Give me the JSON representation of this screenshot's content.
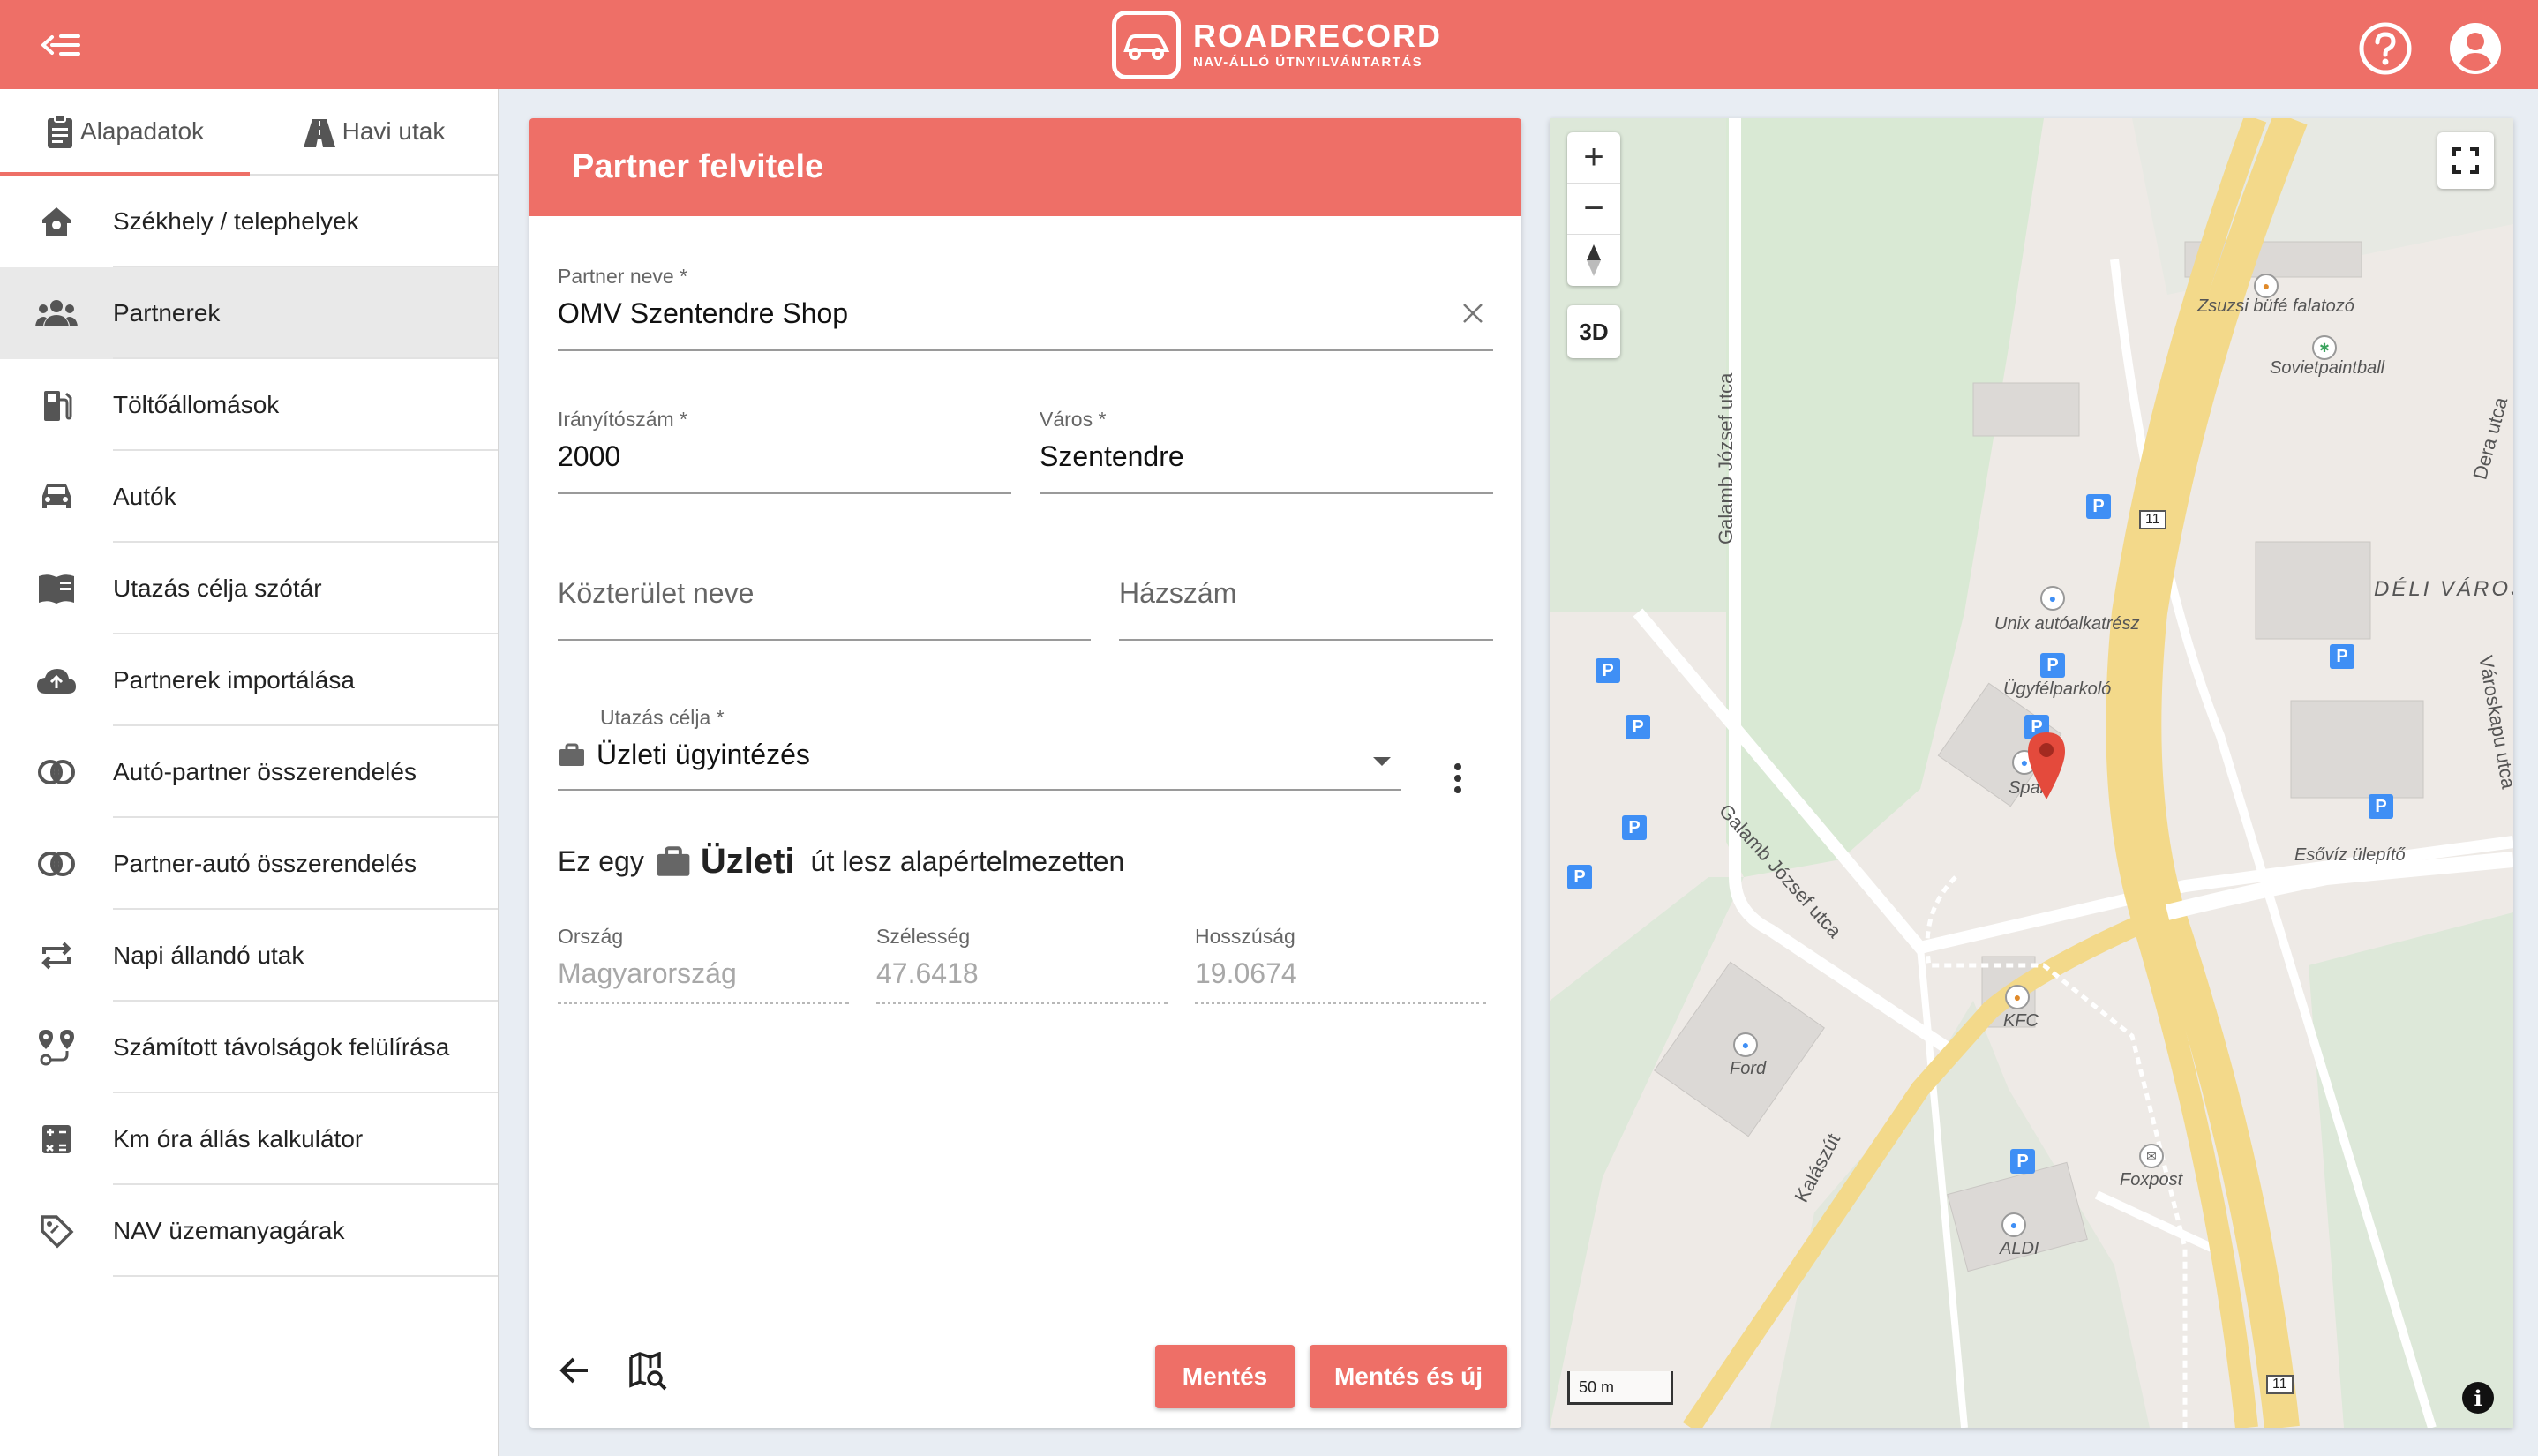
{
  "app": {
    "brand_title": "ROADRECORD",
    "brand_subtitle": "NAV-ÁLLÓ ÚTNYILVÁNTARTÁS",
    "accent_color": "#ee6f67"
  },
  "sidebar": {
    "tabs": [
      {
        "label": "Alapadatok",
        "icon": "clipboard-icon",
        "active": true
      },
      {
        "label": "Havi utak",
        "icon": "road-icon",
        "active": false
      }
    ],
    "items": [
      {
        "label": "Székhely / telephelyek",
        "icon": "home-pin-icon",
        "active": false
      },
      {
        "label": "Partnerek",
        "icon": "people-icon",
        "active": true
      },
      {
        "label": "Töltőállomások",
        "icon": "fuel-icon",
        "active": false
      },
      {
        "label": "Autók",
        "icon": "car-icon",
        "active": false
      },
      {
        "label": "Utazás célja szótár",
        "icon": "book-icon",
        "active": false
      },
      {
        "label": "Partnerek importálása",
        "icon": "cloud-upload-icon",
        "active": false
      },
      {
        "label": "Autó-partner összerendelés",
        "icon": "link-circles-icon",
        "active": false
      },
      {
        "label": "Partner-autó összerendelés",
        "icon": "link-circles-icon",
        "active": false
      },
      {
        "label": "Napi állandó utak",
        "icon": "repeat-icon",
        "active": false
      },
      {
        "label": "Számított távolságok felülírása",
        "icon": "route-pins-icon",
        "active": false
      },
      {
        "label": "Km óra állás kalkulátor",
        "icon": "calculator-icon",
        "active": false
      },
      {
        "label": "NAV üzemanyagárak",
        "icon": "tag-icon",
        "active": false
      }
    ]
  },
  "form": {
    "title": "Partner felvitele",
    "partner_name": {
      "label": "Partner neve *",
      "value": "OMV Szentendre Shop"
    },
    "zip": {
      "label": "Irányítószám *",
      "value": "2000"
    },
    "city": {
      "label": "Város *",
      "value": "Szentendre"
    },
    "street": {
      "placeholder": "Közterület neve"
    },
    "house_no": {
      "placeholder": "Házszám"
    },
    "purpose": {
      "label": "Utazás célja *",
      "value": "Üzleti ügyintézés"
    },
    "info_prefix": "Ez egy",
    "info_type": "Üzleti",
    "info_suffix": "út lesz alapértelmezetten",
    "country": {
      "label": "Ország",
      "value": "Magyarország"
    },
    "latitude": {
      "label": "Szélesség",
      "value": "47.6418"
    },
    "longitude": {
      "label": "Hosszúság",
      "value": "19.0674"
    },
    "save_label": "Mentés",
    "save_new_label": "Mentés és új"
  },
  "map": {
    "zoom_in": "+",
    "zoom_out": "−",
    "btn_3d": "3D",
    "scale": "50 m",
    "road_number": "11",
    "labels": {
      "galamb1": "Galamb József utca",
      "galamb2": "Galamb József utca",
      "dera": "Dera utca",
      "varoskapu": "Városkapu utca",
      "kalasz": "Kalászút",
      "zsuzsi": "Zsuzsi büfé falatozó",
      "soviet": "Sovietpaintball",
      "deli": "DÉLI VÁROS",
      "unix": "Unix autóalkatrész",
      "ugyfel": "Ügyfélparkoló",
      "spar": "Spar",
      "esoviz": "Esővíz ülepítő",
      "kfc": "KFC",
      "ford": "Ford",
      "foxpost": "Foxpost",
      "aldi": "ALDI"
    },
    "parking_letter": "P",
    "pin_color": "#e44a3c"
  }
}
